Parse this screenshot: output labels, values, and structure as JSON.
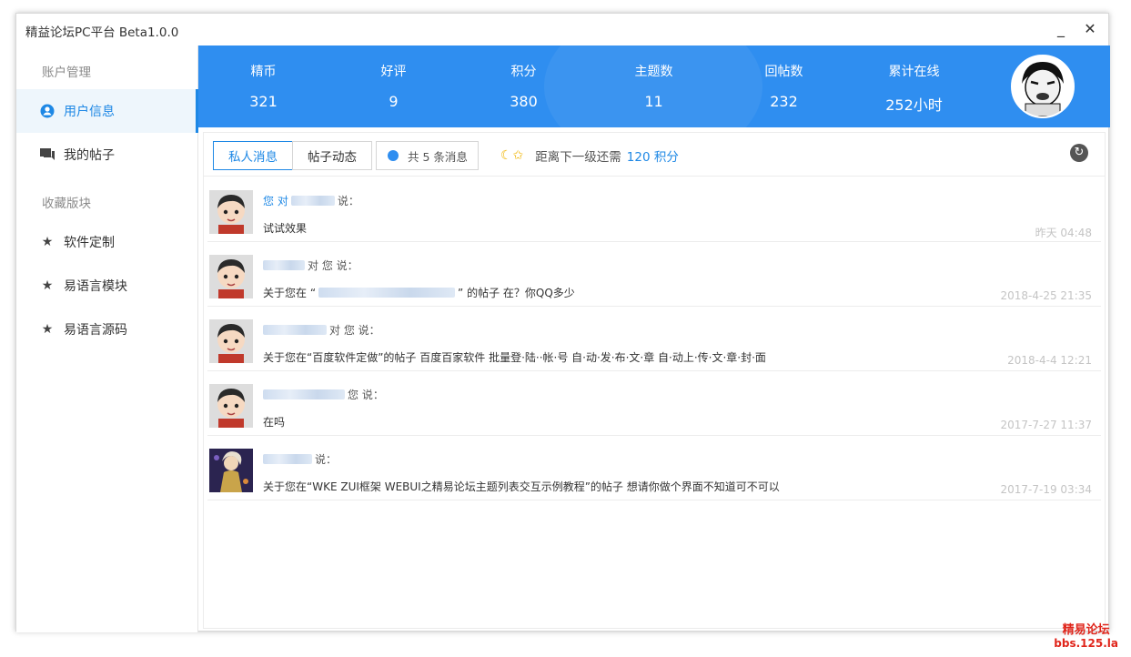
{
  "window": {
    "title": "精益论坛PC平台 Beta1.0.0",
    "minimize_glyph": "_",
    "close_glyph": "✕"
  },
  "sidebar": {
    "sections": [
      "账户管理",
      "收藏版块"
    ],
    "items": [
      {
        "label": "用户信息",
        "icon": "user-circle-icon",
        "active": true
      },
      {
        "label": "我的帖子",
        "icon": "chat-icon",
        "active": false
      },
      {
        "label": "软件定制",
        "icon": "star-icon",
        "active": false
      },
      {
        "label": "易语言模块",
        "icon": "star-icon",
        "active": false
      },
      {
        "label": "易语言源码",
        "icon": "star-icon",
        "active": false
      }
    ]
  },
  "header": {
    "stats": [
      {
        "label": "精币",
        "value": "321"
      },
      {
        "label": "好评",
        "value": "9"
      },
      {
        "label": "积分",
        "value": "380"
      },
      {
        "label": "主题数",
        "value": "11"
      },
      {
        "label": "回帖数",
        "value": "232"
      },
      {
        "label": "累计在线",
        "value": "252小时"
      }
    ],
    "accent": "#2f8ef0"
  },
  "toolbar": {
    "tabs": [
      {
        "label": "私人消息",
        "active": true
      },
      {
        "label": "帖子动态",
        "active": false
      }
    ],
    "count_text": "共 5 条消息",
    "level_prefix": "距离下一级还需",
    "level_value": "120 积分",
    "level_icons": "☾✩"
  },
  "messages": [
    {
      "who_prefix": "您 对",
      "who_suffix": "说：",
      "text_a": "试试效果",
      "text_b": "",
      "time": "昨天 04:48"
    },
    {
      "who_prefix": "对 您 说：",
      "who_suffix": "",
      "text_a": "关于您在 “",
      "text_b": "” 的帖子 在？你QQ多少",
      "time": "2018-4-25 21:35"
    },
    {
      "who_prefix": "对 您 说：",
      "who_suffix": "",
      "text_a": "关于您在“百度软件定做”的帖子 百度百家软件 批量登·陆··帐·号 自·动·发·布·文·章 自·动上·传·文·章·封·面",
      "text_b": "",
      "time": "2018-4-4 12:21"
    },
    {
      "who_prefix": "您 说：",
      "who_suffix": "",
      "text_a": "在吗",
      "text_b": "",
      "time": "2017-7-27 11:37"
    },
    {
      "who_prefix": "说：",
      "who_suffix": "",
      "text_a": "关于您在“WKE ZUI框架 WEBUI之精易论坛主题列表交互示例教程”的帖子 想请你做个界面不知道可不可以",
      "text_b": "",
      "time": "2017-7-19 03:34"
    }
  ],
  "watermark": {
    "line1": "精易论坛",
    "line2": "bbs.125.la"
  }
}
